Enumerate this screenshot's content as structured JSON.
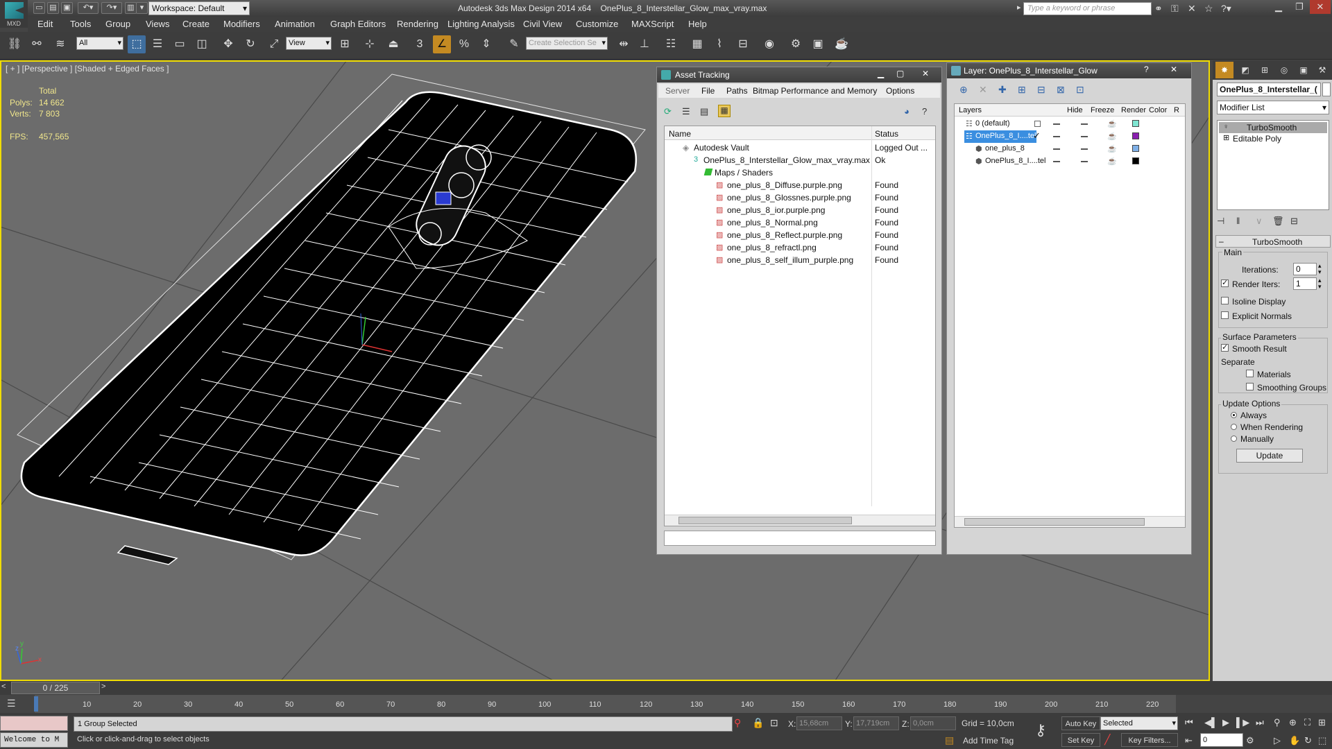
{
  "app": {
    "title": "Autodesk 3ds Max Design 2014 x64",
    "file": "OnePlus_8_Interstellar_Glow_max_vray.max",
    "logo_text": "MXD",
    "workspace": "Workspace: Default",
    "search_placeholder": "Type a keyword or phrase"
  },
  "menu": [
    "Edit",
    "Tools",
    "Group",
    "Views",
    "Create",
    "Modifiers",
    "Animation",
    "Graph Editors",
    "Rendering",
    "Lighting Analysis",
    "Civil View",
    "Customize",
    "MAXScript",
    "Help"
  ],
  "toolbar": {
    "filter": "All",
    "ref_coord": "View",
    "selection_set_placeholder": "Create Selection Se"
  },
  "viewport": {
    "label": "[ + ] [Perspective ] [Shaded + Edged Faces ]",
    "stats": {
      "total_label": "Total",
      "polys_label": "Polys:",
      "polys": "14 662",
      "verts_label": "Verts:",
      "verts": "7 803",
      "fps_label": "FPS:",
      "fps": "457,565"
    },
    "axis": {
      "x": "x",
      "y": "y",
      "z": "z"
    }
  },
  "asset_tracking": {
    "title": "Asset Tracking",
    "menu": [
      "Server",
      "File",
      "Paths",
      "Bitmap Performance and Memory",
      "Options"
    ],
    "columns": [
      "Name",
      "Status"
    ],
    "rows": [
      {
        "name": "Autodesk Vault",
        "status": "Logged Out ..."
      },
      {
        "name": "OnePlus_8_Interstellar_Glow_max_vray.max",
        "status": "Ok"
      },
      {
        "name": "Maps / Shaders",
        "status": ""
      },
      {
        "name": "one_plus_8_Diffuse.purple.png",
        "status": "Found"
      },
      {
        "name": "one_plus_8_Glossnes.purple.png",
        "status": "Found"
      },
      {
        "name": "one_plus_8_ior.purple.png",
        "status": "Found"
      },
      {
        "name": "one_plus_8_Normal.png",
        "status": "Found"
      },
      {
        "name": "one_plus_8_Reflect.purple.png",
        "status": "Found"
      },
      {
        "name": "one_plus_8_refractl.png",
        "status": "Found"
      },
      {
        "name": "one_plus_8_self_illum_purple.png",
        "status": "Found"
      }
    ]
  },
  "layer_panel": {
    "title": "Layer: OnePlus_8_Interstellar_Glow",
    "columns": [
      "Layers",
      "Hide",
      "Freeze",
      "Render",
      "Color",
      "R"
    ],
    "rows": [
      {
        "name": "0 (default)",
        "color": "#7fe6d2"
      },
      {
        "name": "OnePlus_8_I....tellar",
        "color": "#8a1fb0"
      },
      {
        "name": "one_plus_8",
        "color": "#7fb0e8"
      },
      {
        "name": "OnePlus_8_I....tel",
        "color": "#000000"
      }
    ]
  },
  "command_panel": {
    "object_name": "OnePlus_8_Interstellar_(",
    "modifier_list": "Modifier List",
    "stack": [
      "TurboSmooth",
      "Editable Poly"
    ],
    "rollout_title": "TurboSmooth",
    "main_label": "Main",
    "iterations_label": "Iterations:",
    "iterations": "0",
    "render_iters_label": "Render Iters:",
    "render_iters": "1",
    "isoline": "Isoline Display",
    "explicit_normals": "Explicit Normals",
    "surface_params": "Surface Parameters",
    "smooth_result": "Smooth Result",
    "separate": "Separate",
    "materials": "Materials",
    "smoothing_groups": "Smoothing Groups",
    "update_options": "Update Options",
    "always": "Always",
    "when_rendering": "When Rendering",
    "manually": "Manually",
    "update_button": "Update"
  },
  "timeline": {
    "frame": "0 / 225",
    "ticks": [
      "10",
      "20",
      "30",
      "40",
      "50",
      "60",
      "70",
      "80",
      "90",
      "100",
      "110",
      "120",
      "130",
      "140",
      "150",
      "160",
      "170",
      "180",
      "190",
      "200",
      "210",
      "220"
    ]
  },
  "status": {
    "welcome": "Welcome to M",
    "selected": "1 Group Selected",
    "prompt": "Click or click-and-drag to select objects",
    "x_label": "X:",
    "x": "15,68cm",
    "y_label": "Y:",
    "y": "17,719cm",
    "z_label": "Z:",
    "z": "0,0cm",
    "grid": "Grid = 10,0cm",
    "add_time_tag": "Add Time Tag",
    "auto_key": "Auto Key",
    "set_key": "Set Key",
    "selected_dropdown": "Selected",
    "key_filters": "Key Filters...",
    "frame_field": "0"
  }
}
